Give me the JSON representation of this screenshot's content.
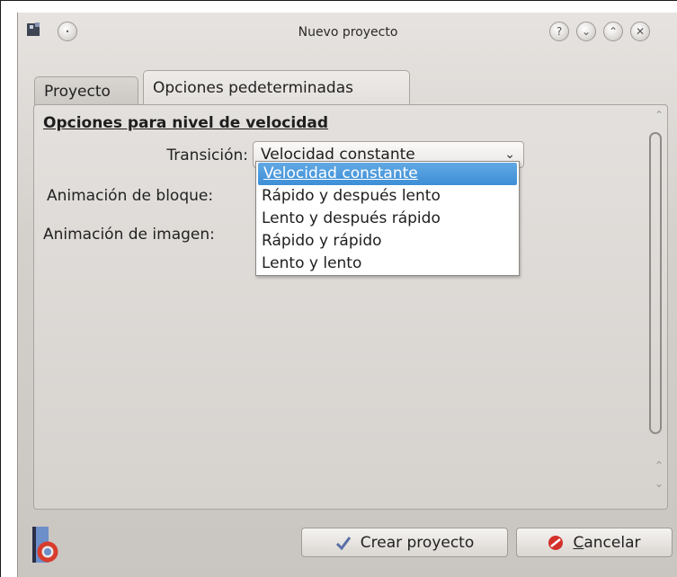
{
  "window": {
    "title": "Nuevo proyecto",
    "controls": [
      "help",
      "minimize",
      "maximize",
      "close"
    ]
  },
  "tabs": [
    {
      "label": "Proyecto",
      "active": false
    },
    {
      "label": "Opciones pedeterminadas",
      "active": true
    }
  ],
  "section": {
    "title": "Opciones para nivel de velocidad"
  },
  "fields": {
    "transition_label": "Transición:",
    "transition_value": "Velocidad constante",
    "block_animation_label": "Animación de bloque:",
    "image_animation_label": "Animación de imagen:"
  },
  "dropdown": {
    "options": [
      "Velocidad constante",
      "Rápido y después lento",
      "Lento y después rápido",
      "Rápido y rápido",
      "Lento y lento"
    ],
    "selected_index": 0
  },
  "buttons": {
    "create": "Crear proyecto",
    "cancel_prefix": "C",
    "cancel_rest": "ancelar"
  },
  "colors": {
    "selection": "#3d8ed6",
    "cancel_icon": "#d4302a",
    "check_icon": "#5b6ea8"
  }
}
